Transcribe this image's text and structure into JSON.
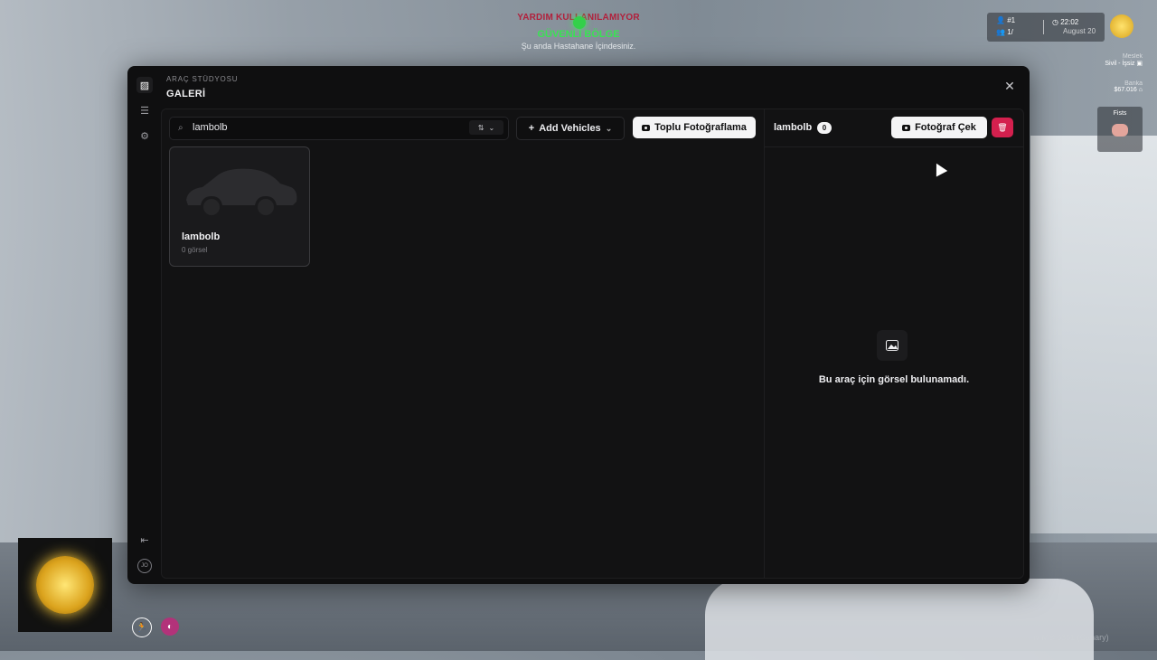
{
  "hud": {
    "help_text": "YARDIM KULLANILAMIYOR",
    "safe_zone": "GÜVENLİ BÖLGE",
    "safe_zone_sub": "Şu anda Hastahane İçindesiniz.",
    "player_id": "#1",
    "players": "1/",
    "time": "22:02",
    "date": "August 20",
    "job_label": "Meslek",
    "job_value": "Sivil - İşsiz",
    "bank_label": "Banka",
    "bank_value": "$67.016",
    "weapon": "Fists",
    "watermark": "Fiv M® 6361 (Canary)",
    "colors": {
      "help_red": "#b21f3b",
      "safe_green": "#39e353",
      "brand_gold": "#d8a21a"
    }
  },
  "modal": {
    "kicker": "ARAÇ STÜDYOSU",
    "title": "GALERİ",
    "rail": {
      "icons": [
        "image-icon",
        "sliders-icon",
        "gear-icon",
        "exit-icon"
      ],
      "avatar_initials": "JO"
    },
    "search": {
      "value": "lambolb",
      "placeholder": ""
    },
    "add_vehicles_label": "Add Vehicles",
    "bulk_photo_label": "Toplu Fotoğraflama",
    "vehicles": [
      {
        "name": "lambolb",
        "images_label": "0 görsel"
      }
    ],
    "right_panel": {
      "vehicle_name": "lambolb",
      "image_count": "0",
      "take_photo_label": "Fotoğraf Çek",
      "empty_message": "Bu araç için görsel bulunamadı."
    },
    "colors": {
      "background": "#0f0f10",
      "danger": "#d4204e"
    }
  }
}
